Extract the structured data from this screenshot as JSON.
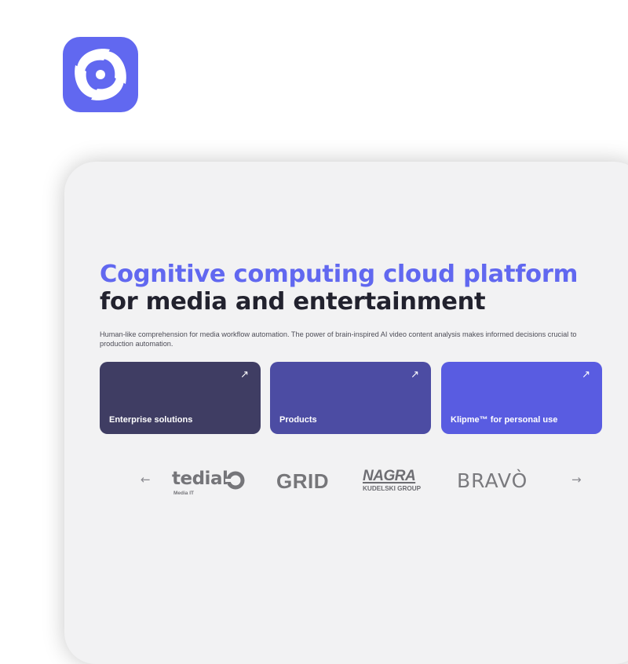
{
  "brand": {
    "logo_icon": "swirl-logo-icon",
    "accent_color": "#6168f0"
  },
  "hero": {
    "headline_accent": "Cognitive computing cloud platform",
    "headline_dark": "for media and entertainment",
    "description": "Human-like comprehension for media workflow automation. The power of brain-inspired AI video content analysis makes informed decisions crucial to production automation."
  },
  "cards": [
    {
      "label": "Enterprise solutions",
      "icon": "arrow-up-right-icon",
      "color": "#3f3d63",
      "arrow": "↗"
    },
    {
      "label": "Products",
      "icon": "arrow-up-right-icon",
      "color": "#4c4ca3",
      "arrow": "↗"
    },
    {
      "label": "Klipme™ for personal use",
      "icon": "arrow-up-right-icon",
      "color": "#595ce1",
      "arrow": "↗"
    }
  ],
  "partners": {
    "prev_arrow": "←",
    "next_arrow": "→",
    "tedial": {
      "name": "tedial",
      "sub": "Media IT"
    },
    "grid": {
      "name": "GRID"
    },
    "nagra": {
      "name": "NAGRA",
      "sub": "KUDELSKI GROUP"
    },
    "bravo": {
      "name": "BRAVÒ"
    }
  }
}
